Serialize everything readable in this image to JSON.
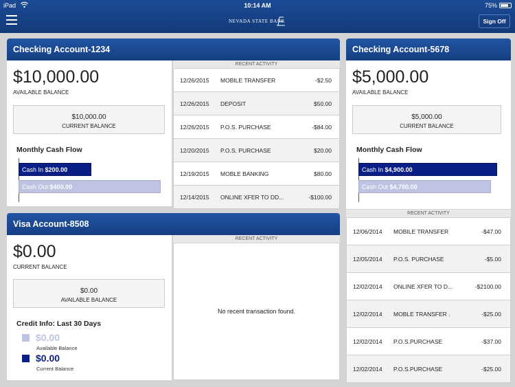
{
  "status_bar": {
    "device": "iPad",
    "time": "10:14 AM",
    "battery": "75%"
  },
  "header": {
    "bank_name": "NEVADA STATE BANK",
    "sign_off_label": "Sign Off"
  },
  "colors": {
    "header_blue": "#1c4b95",
    "cash_in": "#0a1f86",
    "cash_out": "#bec3e2"
  },
  "checking1": {
    "title": "Checking Account-1234",
    "available_amount": "$10,000.00",
    "available_label": "AVAILABLE BALANCE",
    "current_amount": "$10,000.00",
    "current_label": "CURRENT BALANCE",
    "cash_flow_title": "Monthly Cash Flow",
    "cash_in_label": "Cash In",
    "cash_in_value": "$200.00",
    "cash_out_label": "Cash Out",
    "cash_out_value": "$400.00",
    "recent_label": "RECENT ACTIVITY",
    "transactions": [
      {
        "date": "12/26/2015",
        "desc": "MOBILE TRANSFER",
        "amount": "-$2.50"
      },
      {
        "date": "12/26/2015",
        "desc": "DEPOSIT",
        "amount": "$50.00"
      },
      {
        "date": "12/26/2015",
        "desc": "P.O.S. PURCHASE",
        "amount": "-$84.00"
      },
      {
        "date": "12/20/2015",
        "desc": "P.O.S. PURCHASE",
        "amount": "$20.00"
      },
      {
        "date": "12/19/2015",
        "desc": "MOBLE BANKING",
        "amount": "$80.00"
      },
      {
        "date": "12/14/2015",
        "desc": "ONLINE XFER TO DD...",
        "amount": "-$100.00"
      }
    ]
  },
  "checking2": {
    "title": "Checking Account-5678",
    "available_amount": "$5,000.00",
    "available_label": "AVAILABLE BALANCE",
    "current_amount": "$5,000.00",
    "current_label": "CURRENT BALANCE",
    "cash_flow_title": "Monthly Cash Flow",
    "cash_in_label": "Cash In",
    "cash_in_value": "$4,900.00",
    "cash_out_label": "Cash Out",
    "cash_out_value": "$4,700.00",
    "recent_label": "RECENT ACTIVITY",
    "transactions": [
      {
        "date": "12/06/2014",
        "desc": "MOBILE TRANSFER",
        "amount": "-$47.00"
      },
      {
        "date": "12/05/2014",
        "desc": "P.O.S. PURCHASE",
        "amount": "-$5.00"
      },
      {
        "date": "12/02/2014",
        "desc": "ONLINE XFER TO D...",
        "amount": "-$2100.00"
      },
      {
        "date": "12/02/2014",
        "desc": "MOBLE TRANSFER  .",
        "amount": "-$25.00"
      },
      {
        "date": "12/02/2014",
        "desc": "P.O.S.PURCHASE",
        "amount": "-$37.00"
      },
      {
        "date": "12/02/2014",
        "desc": "P.O.S.PURCHASE",
        "amount": "-$25.00"
      }
    ]
  },
  "visa": {
    "title": "Visa Account-8508",
    "current_amount": "$0.00",
    "current_label": "CURRENT BALANCE",
    "available_amount": "$0.00",
    "available_label": "AVAILABLE BALANCE",
    "credit_title": "Credit Info: Last 30 Days",
    "legend": [
      {
        "amount": "$0.00",
        "label": "Available Balance"
      },
      {
        "amount": "$0.00",
        "label": "Current Balance"
      }
    ],
    "recent_label": "RECENT ACTIVITY",
    "empty_message": "No recent transaction found."
  }
}
